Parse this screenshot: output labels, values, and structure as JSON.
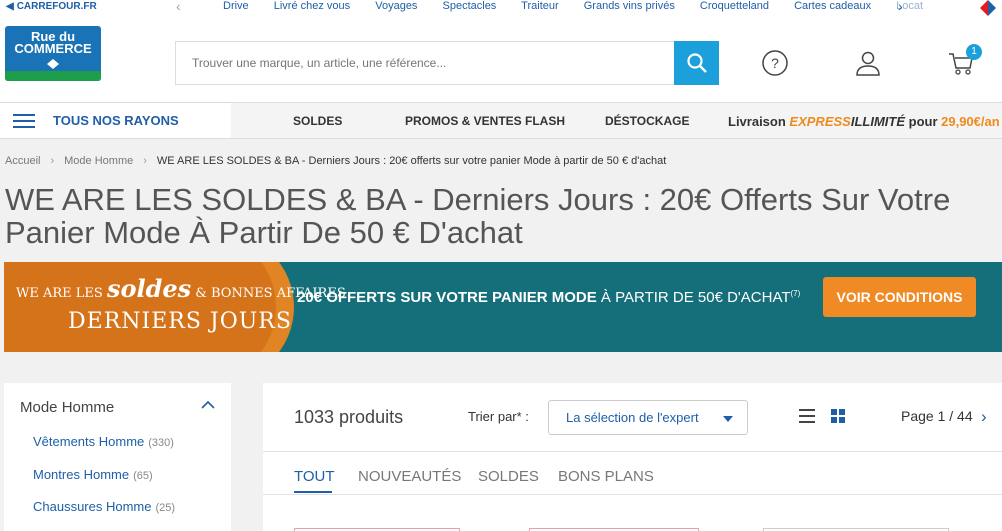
{
  "topbar": {
    "carrefour_link": "CARREFOUR.FR",
    "links": [
      "Drive",
      "Livré chez vous",
      "Voyages",
      "Spectacles",
      "Traiteur",
      "Grands vins privés",
      "Croquetteland",
      "Cartes cadeaux",
      "Locat"
    ]
  },
  "header": {
    "logo_line1": "Rue du",
    "logo_line2": "COMMERCE",
    "search_placeholder": "Trouver une marque, un article, une référence...",
    "cart_count": "1"
  },
  "nav": {
    "all_categories": "TOUS NOS RAYONS",
    "items": [
      "SOLDES",
      "PROMOS & VENTES FLASH",
      "DÉSTOCKAGE"
    ],
    "delivery_prefix": "Livraison ",
    "delivery_express": "EXPRESS",
    "delivery_unlimited": "ILLIMITÉ",
    "delivery_mid": " pour ",
    "delivery_price": "29,90€/an"
  },
  "breadcrumb": {
    "items": [
      "Accueil",
      "Mode Homme"
    ],
    "current": "WE ARE LES SOLDES & BA - Derniers Jours : 20€ offerts sur votre panier Mode à partir de 50 € d'achat"
  },
  "page_title": "WE ARE LES SOLDES & BA - Derniers Jours : 20€ Offerts Sur Votre Panier Mode À Partir De 50 € D'achat",
  "banner": {
    "brand_prefix": "WE ARE LES ",
    "brand_soldes": "soldes",
    "brand_suffix": " & BONNES AFFAIRES",
    "brand_line2": "DERNIERS JOURS",
    "offer_bold": "20€ OFFERTS SUR VOTRE PANIER MODE",
    "offer_rest": " À PARTIR DE 50€ D'ACHAT",
    "offer_note": "(7)",
    "cta": "VOIR CONDITIONS"
  },
  "sidebar": {
    "heading": "Mode Homme",
    "items": [
      {
        "label": "Vêtements Homme",
        "count": "(330)"
      },
      {
        "label": "Montres Homme",
        "count": "(65)"
      },
      {
        "label": "Chaussures Homme",
        "count": "(25)"
      }
    ]
  },
  "results": {
    "count": "1033 produits",
    "sort_label": "Trier par* :",
    "sort_value": "La sélection de l'expert",
    "page": "Page 1 / 44",
    "tabs": [
      "TOUT",
      "NOUVEAUTÉS",
      "SOLDES",
      "BONS PLANS"
    ]
  },
  "colors": {
    "brand_blue": "#1e5fa8",
    "accent_cyan": "#1ba0db",
    "orange": "#f08a25",
    "banner_teal": "#156f7b"
  }
}
